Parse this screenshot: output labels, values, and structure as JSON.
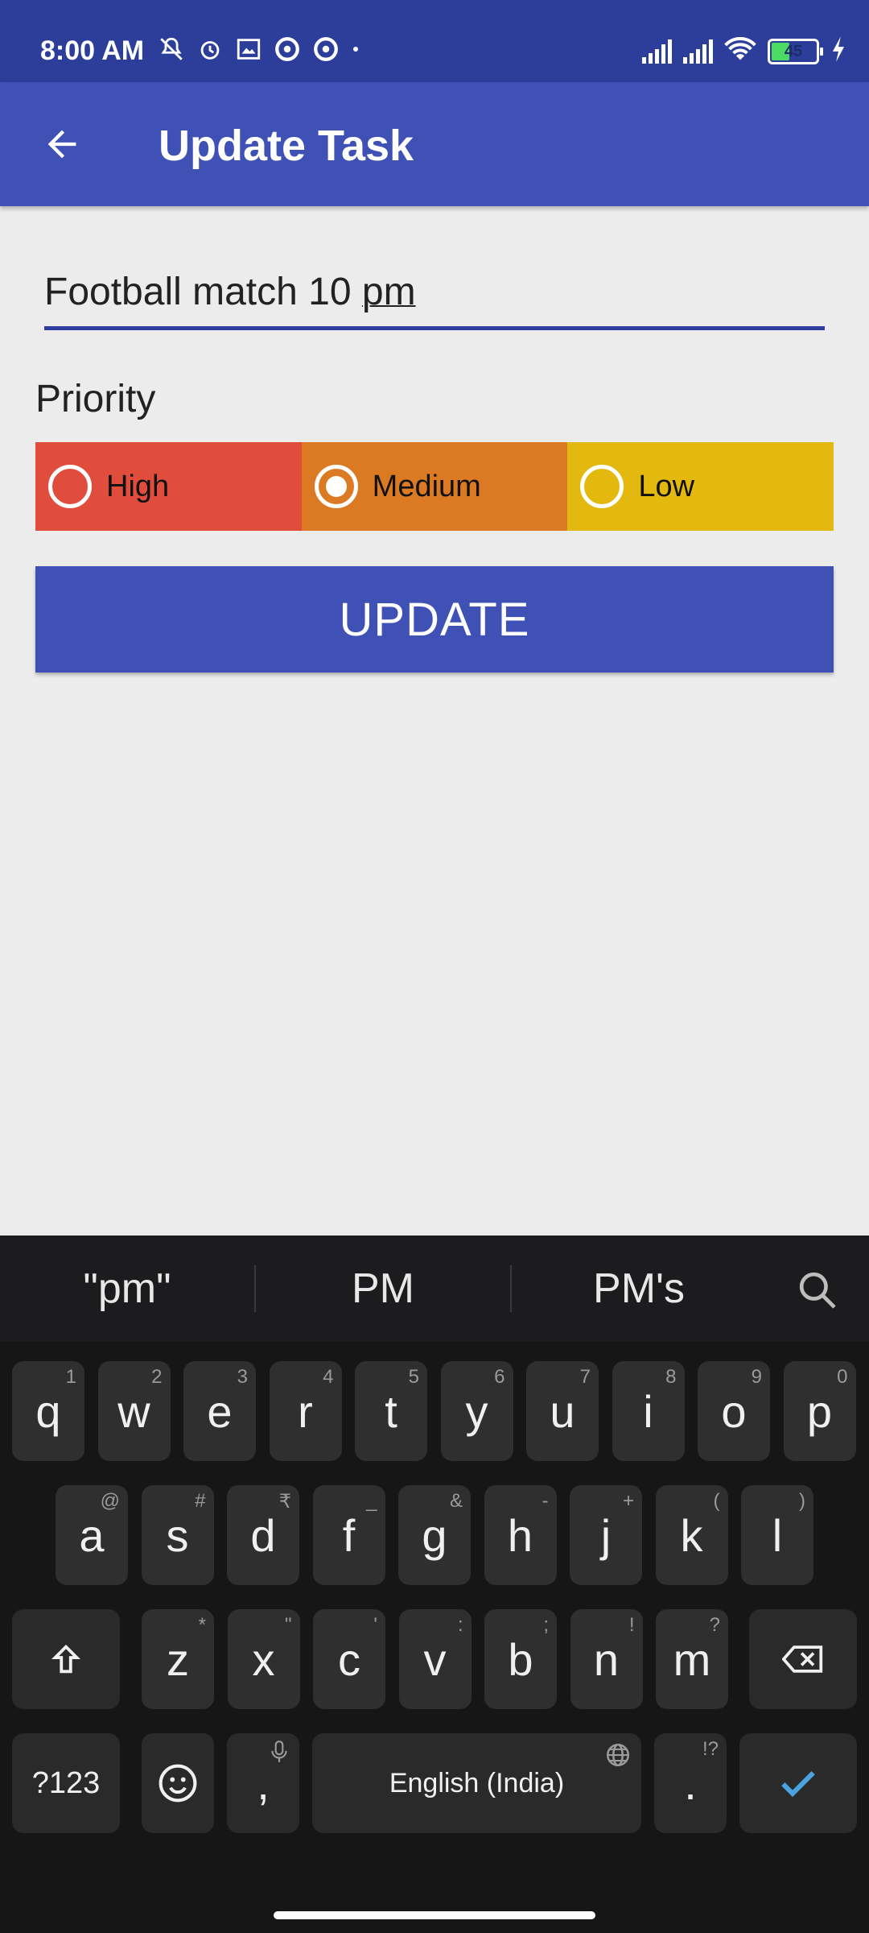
{
  "status_bar": {
    "time": "8:00 AM",
    "battery_level": "45",
    "battery_fraction": 0.45,
    "left_icons": [
      "notification-muted-icon",
      "alarm-icon",
      "photo-icon",
      "vpn-icon",
      "vpn-icon",
      "more-dot-icon"
    ],
    "right_icons": [
      "signal-icon",
      "signal-icon",
      "wifi-icon",
      "battery-icon",
      "charging-icon"
    ]
  },
  "app_bar": {
    "title": "Update Task",
    "back_icon": "arrow-back-icon"
  },
  "form": {
    "task_text_main": "Football match 10 ",
    "task_text_underlined": "pm",
    "task_value": "Football match 10 pm",
    "priority_label": "Priority",
    "priorities": [
      {
        "label": "High",
        "color": "#e04d3d",
        "checked": false
      },
      {
        "label": "Medium",
        "color": "#dc7a23",
        "checked": true
      },
      {
        "label": "Low",
        "color": "#e3b90f",
        "checked": false
      }
    ],
    "update_button": "UPDATE"
  },
  "keyboard": {
    "suggestions": [
      "\"pm\"",
      "PM",
      "PM's"
    ],
    "row1": [
      {
        "k": "q",
        "h": "1"
      },
      {
        "k": "w",
        "h": "2"
      },
      {
        "k": "e",
        "h": "3"
      },
      {
        "k": "r",
        "h": "4"
      },
      {
        "k": "t",
        "h": "5"
      },
      {
        "k": "y",
        "h": "6"
      },
      {
        "k": "u",
        "h": "7"
      },
      {
        "k": "i",
        "h": "8"
      },
      {
        "k": "o",
        "h": "9"
      },
      {
        "k": "p",
        "h": "0"
      }
    ],
    "row2": [
      {
        "k": "a",
        "h": "@"
      },
      {
        "k": "s",
        "h": "#"
      },
      {
        "k": "d",
        "h": "₹"
      },
      {
        "k": "f",
        "h": "_"
      },
      {
        "k": "g",
        "h": "&"
      },
      {
        "k": "h",
        "h": "-"
      },
      {
        "k": "j",
        "h": "+"
      },
      {
        "k": "k",
        "h": "("
      },
      {
        "k": "l",
        "h": ")"
      }
    ],
    "row3": [
      {
        "k": "z",
        "h": "*"
      },
      {
        "k": "x",
        "h": "\""
      },
      {
        "k": "c",
        "h": "'"
      },
      {
        "k": "v",
        "h": ":"
      },
      {
        "k": "b",
        "h": ";"
      },
      {
        "k": "n",
        "h": "!"
      },
      {
        "k": "m",
        "h": "?"
      }
    ],
    "symbols_key": "?123",
    "comma_key": ",",
    "space_key": "English (India)",
    "period_key": ".",
    "period_hint": "!?",
    "accent_color": "#4aa3df"
  }
}
